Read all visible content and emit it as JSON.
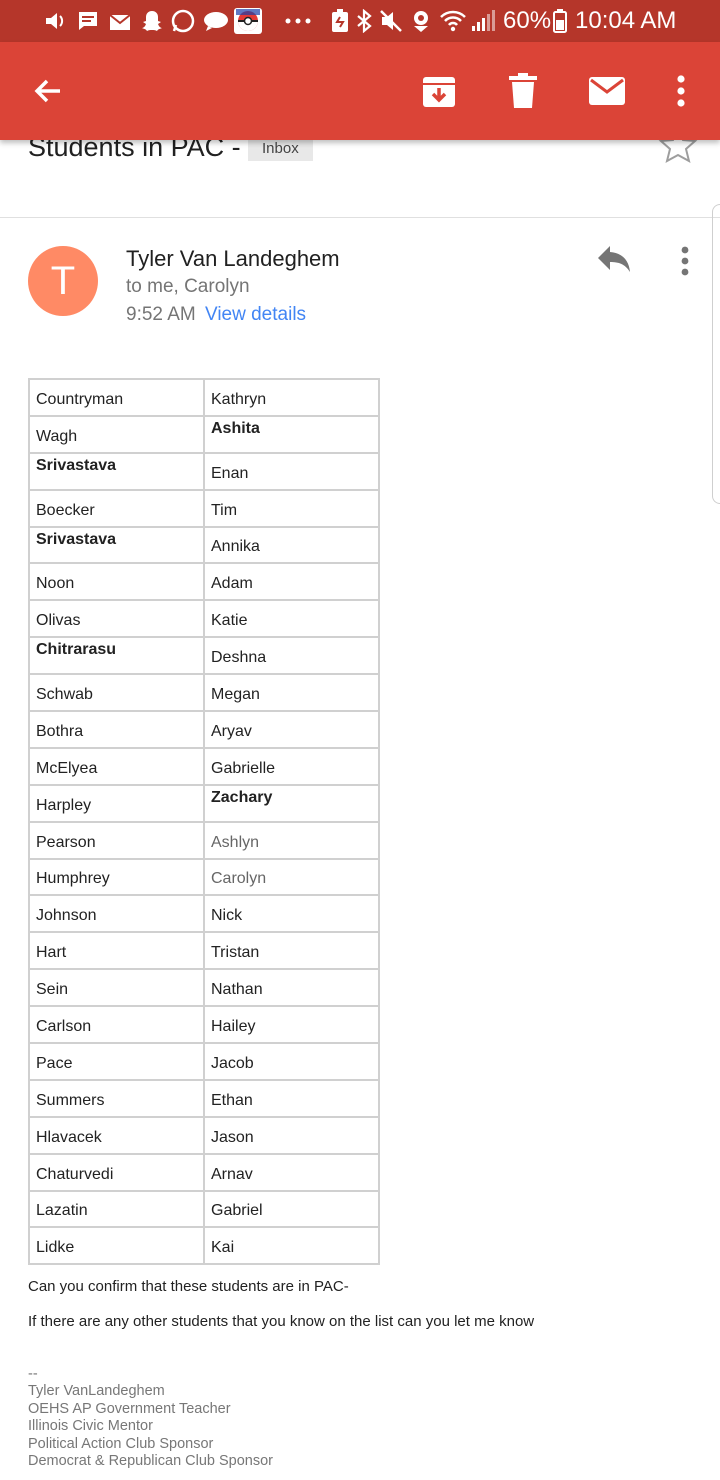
{
  "status_bar": {
    "battery": "60%",
    "time": "10:04 AM",
    "left_icons": [
      "volume-icon",
      "message-icon",
      "mail-icon",
      "snapchat-icon",
      "whatsapp-icon",
      "chat-bubble-icon",
      "pokeball-icon",
      "more-dots-icon"
    ],
    "right_icons": [
      "battery-saver-icon",
      "bluetooth-icon",
      "mute-icon",
      "location-icon",
      "wifi-icon",
      "signal-icon",
      "battery-icon"
    ]
  },
  "action_bar": {
    "back_icon": "arrow-back-icon",
    "archive_icon": "archive-icon",
    "delete_icon": "trash-icon",
    "mark_unread_icon": "envelope-icon",
    "more_icon": "more-vert-icon"
  },
  "email": {
    "subject": "Students in PAC -",
    "label": "Inbox",
    "avatar_letter": "T",
    "avatar_color": "#ff8a65",
    "sender": "Tyler Van Landeghem",
    "recipients": "to me, Carolyn",
    "time": "9:52 AM",
    "view_details": "View details"
  },
  "students": [
    {
      "last": "Countryman",
      "first": "Kathryn"
    },
    {
      "last": "Wagh",
      "first": "Ashita",
      "first_bold": true
    },
    {
      "last": "Srivastava",
      "first": "Enan",
      "last_bold": true
    },
    {
      "last": "Boecker",
      "first": "Tim"
    },
    {
      "last": "Srivastava",
      "first": "Annika",
      "last_bold": true
    },
    {
      "last": "Noon",
      "first": "Adam"
    },
    {
      "last": "Olivas",
      "first": "Katie"
    },
    {
      "last": "Chitrarasu",
      "first": "Deshna",
      "last_bold": true
    },
    {
      "last": "Schwab",
      "first": "Megan"
    },
    {
      "last": "Bothra",
      "first": "Aryav"
    },
    {
      "last": "McElyea",
      "first": "Gabrielle"
    },
    {
      "last": "Harpley",
      "first": "Zachary",
      "first_bold": true
    },
    {
      "last": "Pearson",
      "first": "Ashlyn",
      "first_grey": true
    },
    {
      "last": "Humphrey",
      "first": "Carolyn",
      "first_grey": true
    },
    {
      "last": "Johnson",
      "first": "Nick"
    },
    {
      "last": "Hart",
      "first": "Tristan"
    },
    {
      "last": "Sein",
      "first": "Nathan"
    },
    {
      "last": "Carlson",
      "first": "Hailey"
    },
    {
      "last": "Pace",
      "first": "Jacob"
    },
    {
      "last": "Summers",
      "first": "Ethan"
    },
    {
      "last": "Hlavacek",
      "first": "Jason"
    },
    {
      "last": "Chaturvedi",
      "first": "Arnav"
    },
    {
      "last": "Lazatin",
      "first": "Gabriel"
    },
    {
      "last": "Lidke",
      "first": "Kai"
    }
  ],
  "body": {
    "line1": "Can you confirm that these students are in PAC-",
    "line2": "If there are any other students that you know on the list can you let me know"
  },
  "signature": {
    "separator": "--",
    "lines": [
      "Tyler VanLandeghem",
      "OEHS AP Government Teacher",
      "Illinois Civic Mentor",
      "Political Action Club Sponsor",
      "Democrat & Republican Club Sponsor"
    ]
  },
  "colors": {
    "status_bar": "#b5362a",
    "action_bar": "#db4437",
    "link": "#4285f4"
  }
}
